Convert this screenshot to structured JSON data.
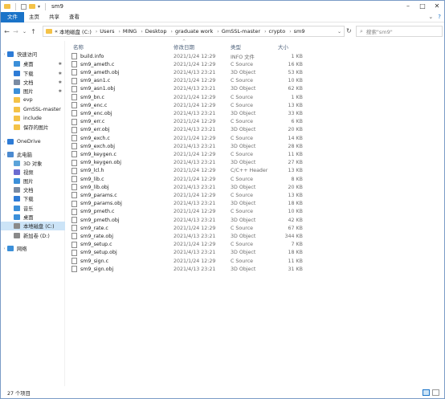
{
  "window": {
    "title": "sm9"
  },
  "ribbon": {
    "tabs": [
      "文件",
      "主页",
      "共享",
      "查看"
    ],
    "help": "?"
  },
  "address": {
    "overflow": "«",
    "crumbs": [
      "本地磁盘 (C:)",
      "Users",
      "MING",
      "Desktop",
      "graduate work",
      "GmSSL-master",
      "crypto",
      "sm9"
    ],
    "search_placeholder": "搜索\"sm9\""
  },
  "nav": {
    "items": [
      {
        "label": "快速访问",
        "kind": "star"
      },
      {
        "label": "桌面",
        "kind": "desktop"
      },
      {
        "label": "下载",
        "kind": "download"
      },
      {
        "label": "文档",
        "kind": "doc"
      },
      {
        "label": "图片",
        "kind": "pic"
      },
      {
        "label": "evp",
        "kind": "folder"
      },
      {
        "label": "GmSSL-master",
        "kind": "folder"
      },
      {
        "label": "include",
        "kind": "folder"
      },
      {
        "label": "保存的图片",
        "kind": "folder"
      },
      {
        "label": "OneDrive",
        "kind": "cloud"
      },
      {
        "label": "此电脑",
        "kind": "pc"
      },
      {
        "label": "3D 对象",
        "kind": "3d"
      },
      {
        "label": "视频",
        "kind": "video"
      },
      {
        "label": "图片",
        "kind": "pic"
      },
      {
        "label": "文档",
        "kind": "doc"
      },
      {
        "label": "下载",
        "kind": "download"
      },
      {
        "label": "音乐",
        "kind": "music"
      },
      {
        "label": "桌面",
        "kind": "desktop"
      },
      {
        "label": "本地磁盘 (C:)",
        "kind": "drive"
      },
      {
        "label": "新加卷 (D:)",
        "kind": "drive"
      },
      {
        "label": "网络",
        "kind": "network"
      }
    ]
  },
  "columns": {
    "name": "名称",
    "date": "修改日期",
    "type": "类型",
    "size": "大小"
  },
  "files": [
    {
      "name": "build.info",
      "date": "2021/1/24 12:29",
      "type": "INFO 文件",
      "size": "1 KB"
    },
    {
      "name": "sm9_ameth.c",
      "date": "2021/1/24 12:29",
      "type": "C Source",
      "size": "16 KB"
    },
    {
      "name": "sm9_ameth.obj",
      "date": "2021/4/13 23:21",
      "type": "3D Object",
      "size": "53 KB"
    },
    {
      "name": "sm9_asn1.c",
      "date": "2021/1/24 12:29",
      "type": "C Source",
      "size": "10 KB"
    },
    {
      "name": "sm9_asn1.obj",
      "date": "2021/4/13 23:21",
      "type": "3D Object",
      "size": "62 KB"
    },
    {
      "name": "sm9_bn.c",
      "date": "2021/1/24 12:29",
      "type": "C Source",
      "size": "1 KB"
    },
    {
      "name": "sm9_enc.c",
      "date": "2021/1/24 12:29",
      "type": "C Source",
      "size": "13 KB"
    },
    {
      "name": "sm9_enc.obj",
      "date": "2021/4/13 23:21",
      "type": "3D Object",
      "size": "33 KB"
    },
    {
      "name": "sm9_err.c",
      "date": "2021/1/24 12:29",
      "type": "C Source",
      "size": "6 KB"
    },
    {
      "name": "sm9_err.obj",
      "date": "2021/4/13 23:21",
      "type": "3D Object",
      "size": "20 KB"
    },
    {
      "name": "sm9_exch.c",
      "date": "2021/1/24 12:29",
      "type": "C Source",
      "size": "14 KB"
    },
    {
      "name": "sm9_exch.obj",
      "date": "2021/4/13 23:21",
      "type": "3D Object",
      "size": "28 KB"
    },
    {
      "name": "sm9_keygen.c",
      "date": "2021/1/24 12:29",
      "type": "C Source",
      "size": "11 KB"
    },
    {
      "name": "sm9_keygen.obj",
      "date": "2021/4/13 23:21",
      "type": "3D Object",
      "size": "27 KB"
    },
    {
      "name": "sm9_lcl.h",
      "date": "2021/1/24 12:29",
      "type": "C/C++ Header",
      "size": "13 KB"
    },
    {
      "name": "sm9_lib.c",
      "date": "2021/1/24 12:29",
      "type": "C Source",
      "size": "8 KB"
    },
    {
      "name": "sm9_lib.obj",
      "date": "2021/4/13 23:21",
      "type": "3D Object",
      "size": "20 KB"
    },
    {
      "name": "sm9_params.c",
      "date": "2021/1/24 12:29",
      "type": "C Source",
      "size": "13 KB"
    },
    {
      "name": "sm9_params.obj",
      "date": "2021/4/13 23:21",
      "type": "3D Object",
      "size": "18 KB"
    },
    {
      "name": "sm9_pmeth.c",
      "date": "2021/1/24 12:29",
      "type": "C Source",
      "size": "10 KB"
    },
    {
      "name": "sm9_pmeth.obj",
      "date": "2021/4/13 23:21",
      "type": "3D Object",
      "size": "42 KB"
    },
    {
      "name": "sm9_rate.c",
      "date": "2021/1/24 12:29",
      "type": "C Source",
      "size": "67 KB"
    },
    {
      "name": "sm9_rate.obj",
      "date": "2021/4/13 23:21",
      "type": "3D Object",
      "size": "344 KB"
    },
    {
      "name": "sm9_setup.c",
      "date": "2021/1/24 12:29",
      "type": "C Source",
      "size": "7 KB"
    },
    {
      "name": "sm9_setup.obj",
      "date": "2021/4/13 23:21",
      "type": "3D Object",
      "size": "18 KB"
    },
    {
      "name": "sm9_sign.c",
      "date": "2021/1/24 12:29",
      "type": "C Source",
      "size": "11 KB"
    },
    {
      "name": "sm9_sign.obj",
      "date": "2021/4/13 23:21",
      "type": "3D Object",
      "size": "31 KB"
    }
  ],
  "status": {
    "count": "27 个项目"
  },
  "colors": {
    "accent": "#1a73c8",
    "selection": "#cce4f7",
    "folder": "#f4c247"
  }
}
